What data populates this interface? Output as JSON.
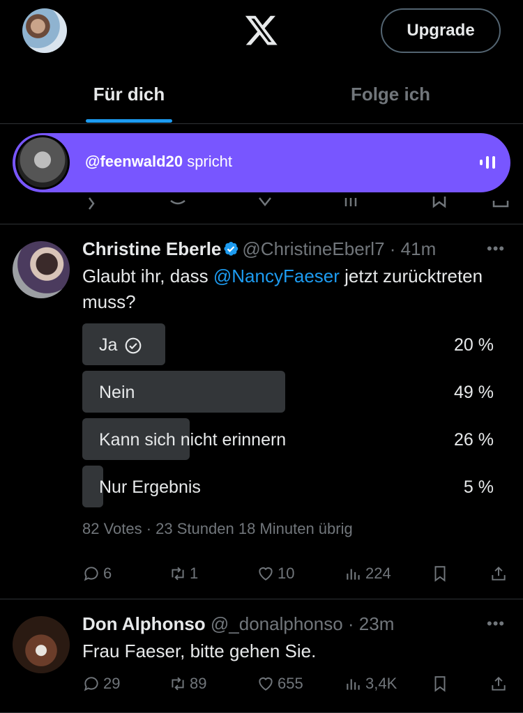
{
  "header": {
    "upgrade_label": "Upgrade"
  },
  "tabs": [
    {
      "label": "Für dich"
    },
    {
      "label": "Folge ich"
    }
  ],
  "space": {
    "host": "@feenwald20",
    "status": "spricht"
  },
  "tweets": [
    {
      "name": "Christine Eberle",
      "handle": "@ChristineEberl7",
      "time": "· 41m",
      "text_before": "Glaubt ihr, dass ",
      "mention": "@NancyFaeser",
      "text_after": " jetzt zurücktreten muss?",
      "poll": {
        "options": [
          {
            "label": "Ja",
            "percent_text": "20 %",
            "percent": 20
          },
          {
            "label": "Nein",
            "percent_text": "49 %",
            "percent": 49
          },
          {
            "label": "Kann sich nicht erinnern",
            "percent_text": "26 %",
            "percent": 26
          },
          {
            "label": "Nur Ergebnis",
            "percent_text": "5 %",
            "percent": 5
          }
        ],
        "meta": "82 Votes · 23 Stunden 18 Minuten übrig"
      },
      "replies": "6",
      "retweets": "1",
      "likes": "10",
      "views": "224"
    },
    {
      "name": "Don Alphonso",
      "handle": "@_donalphonso",
      "time": "· 23m",
      "text": "Frau Faeser, bitte gehen Sie.",
      "replies": "29",
      "retweets": "89",
      "likes": "655",
      "views": "3,4K"
    }
  ],
  "colors": {
    "accent": "#1d9bf0",
    "space": "#7856ff",
    "poll_fill": "#333639",
    "muted": "#71767b"
  }
}
